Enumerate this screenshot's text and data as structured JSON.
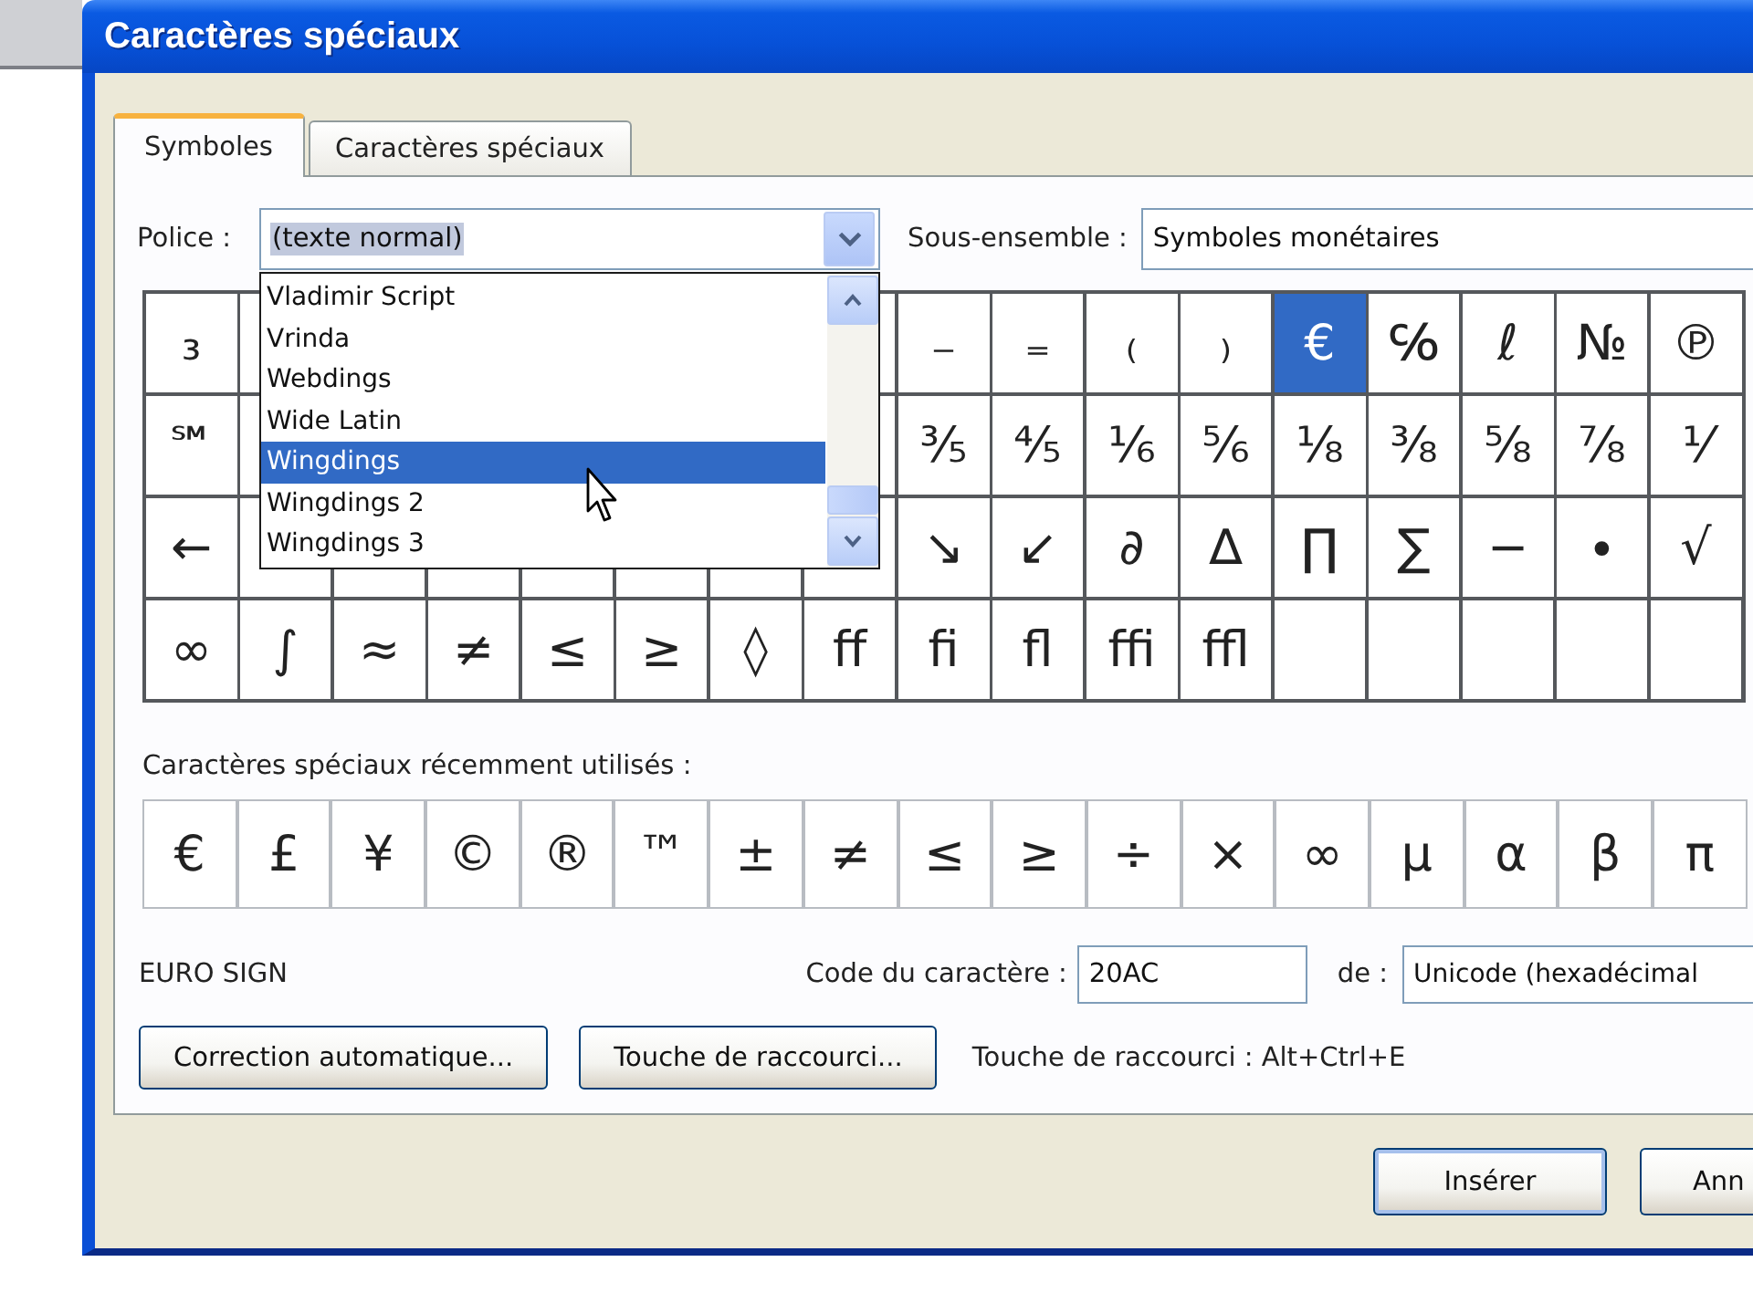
{
  "window": {
    "title": "Caractères spéciaux"
  },
  "tabs": [
    {
      "label": "Symboles",
      "selected": true
    },
    {
      "label": "Caractères spéciaux",
      "selected": false
    }
  ],
  "font": {
    "label": "Police :",
    "value": "(texte normal)",
    "value_highlighted": true,
    "expanded": true,
    "options": [
      {
        "label": "Vladimir Script",
        "selected": false
      },
      {
        "label": "Vrinda",
        "selected": false
      },
      {
        "label": "Webdings",
        "selected": false
      },
      {
        "label": "Wide Latin",
        "selected": false
      },
      {
        "label": "Wingdings",
        "selected": true
      },
      {
        "label": "Wingdings 2",
        "selected": false
      },
      {
        "label": "Wingdings 3",
        "selected": false
      }
    ]
  },
  "subset": {
    "label": "Sous-ensemble :",
    "value": "Symboles monétaires"
  },
  "symbol_grid": {
    "rows": [
      [
        {
          "char": "₃",
          "selected": false
        },
        null,
        null,
        null,
        null,
        null,
        null,
        null,
        {
          "char": "₋",
          "selected": false
        },
        {
          "char": "₌",
          "selected": false
        },
        {
          "char": "₍",
          "selected": false
        },
        {
          "char": "₎",
          "selected": false
        },
        {
          "char": "€",
          "selected": true
        },
        {
          "char": "℅",
          "selected": false
        },
        {
          "char": "ℓ",
          "selected": false
        },
        {
          "char": "№",
          "selected": false
        },
        {
          "char": "℗",
          "selected": false
        }
      ],
      [
        {
          "char": "℠",
          "selected": false
        },
        null,
        null,
        null,
        null,
        null,
        null,
        null,
        {
          "char": "⅗",
          "selected": false
        },
        {
          "char": "⅘",
          "selected": false
        },
        {
          "char": "⅙",
          "selected": false
        },
        {
          "char": "⅚",
          "selected": false
        },
        {
          "char": "⅛",
          "selected": false
        },
        {
          "char": "⅜",
          "selected": false
        },
        {
          "char": "⅝",
          "selected": false
        },
        {
          "char": "⅞",
          "selected": false
        },
        {
          "char": "⅟",
          "selected": false
        }
      ],
      [
        {
          "char": "←",
          "selected": false
        },
        null,
        null,
        null,
        null,
        null,
        null,
        null,
        {
          "char": "↘",
          "selected": false
        },
        {
          "char": "↙",
          "selected": false
        },
        {
          "char": "∂",
          "selected": false
        },
        {
          "char": "∆",
          "selected": false
        },
        {
          "char": "∏",
          "selected": false
        },
        {
          "char": "∑",
          "selected": false
        },
        {
          "char": "−",
          "selected": false
        },
        {
          "char": "∙",
          "selected": false
        },
        {
          "char": "√",
          "selected": false
        }
      ],
      [
        {
          "char": "∞",
          "selected": false
        },
        {
          "char": "∫",
          "selected": false
        },
        {
          "char": "≈",
          "selected": false
        },
        {
          "char": "≠",
          "selected": false
        },
        {
          "char": "≤",
          "selected": false
        },
        {
          "char": "≥",
          "selected": false
        },
        {
          "char": "◊",
          "selected": false
        },
        {
          "char": "ﬀ",
          "selected": false
        },
        {
          "char": "ﬁ",
          "selected": false
        },
        {
          "char": "ﬂ",
          "selected": false
        },
        {
          "char": "ﬃ",
          "selected": false
        },
        {
          "char": "ﬄ",
          "selected": false
        },
        null,
        null,
        null,
        null,
        null
      ]
    ]
  },
  "recent": {
    "label": "Caractères spéciaux récemment utilisés :",
    "symbols": [
      "€",
      "£",
      "¥",
      "©",
      "®",
      "™",
      "±",
      "≠",
      "≤",
      "≥",
      "÷",
      "×",
      "∞",
      "µ",
      "α",
      "β",
      "π"
    ]
  },
  "character_name": "EURO SIGN",
  "character_code": {
    "label": "Code du caractère :",
    "value": "20AC"
  },
  "code_from": {
    "label": "de :",
    "value": "Unicode (hexadécimal"
  },
  "buttons": [
    {
      "label": "Correction automatique..."
    },
    {
      "label": "Touche de raccourci..."
    }
  ],
  "shortcut_text": "Touche de raccourci : Alt+Ctrl+E",
  "dialog_buttons": [
    {
      "label": "Insérer",
      "default": true
    },
    {
      "label": "Ann",
      "default": false
    }
  ]
}
